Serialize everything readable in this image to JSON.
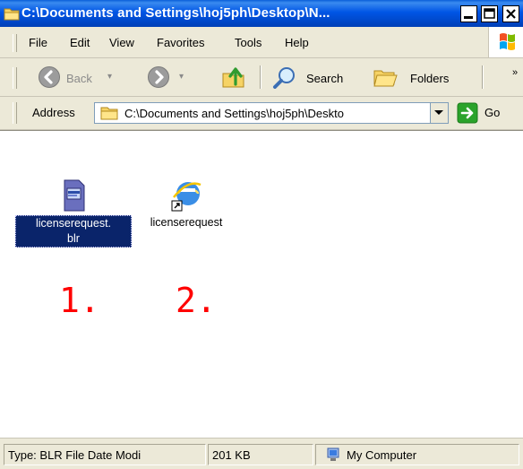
{
  "window": {
    "title": "C:\\Documents and Settings\\hoj5ph\\Desktop\\N..."
  },
  "menu": [
    "File",
    "Edit",
    "View",
    "Favorites",
    "Tools",
    "Help"
  ],
  "toolbar": {
    "back_label": "Back",
    "search_label": "Search",
    "folders_label": "Folders"
  },
  "address": {
    "label": "Address",
    "value": "C:\\Documents and Settings\\hoj5ph\\Deskto",
    "go_label": "Go"
  },
  "files": [
    {
      "name_line1": "licenserequest.",
      "name_line2": "blr",
      "icon": "blr-file-icon",
      "selected": true
    },
    {
      "name_line1": "licenserequest",
      "icon": "internet-shortcut-icon",
      "selected": false
    }
  ],
  "annotations": [
    "1.",
    "2."
  ],
  "status": {
    "type_info": "Type: BLR File Date Modi",
    "size": "201 KB",
    "location": "My Computer"
  },
  "colors": {
    "titlebar": "#0055e5",
    "selection": "#0a246a",
    "annotation": "#ff0000",
    "chrome": "#ece9d8"
  }
}
